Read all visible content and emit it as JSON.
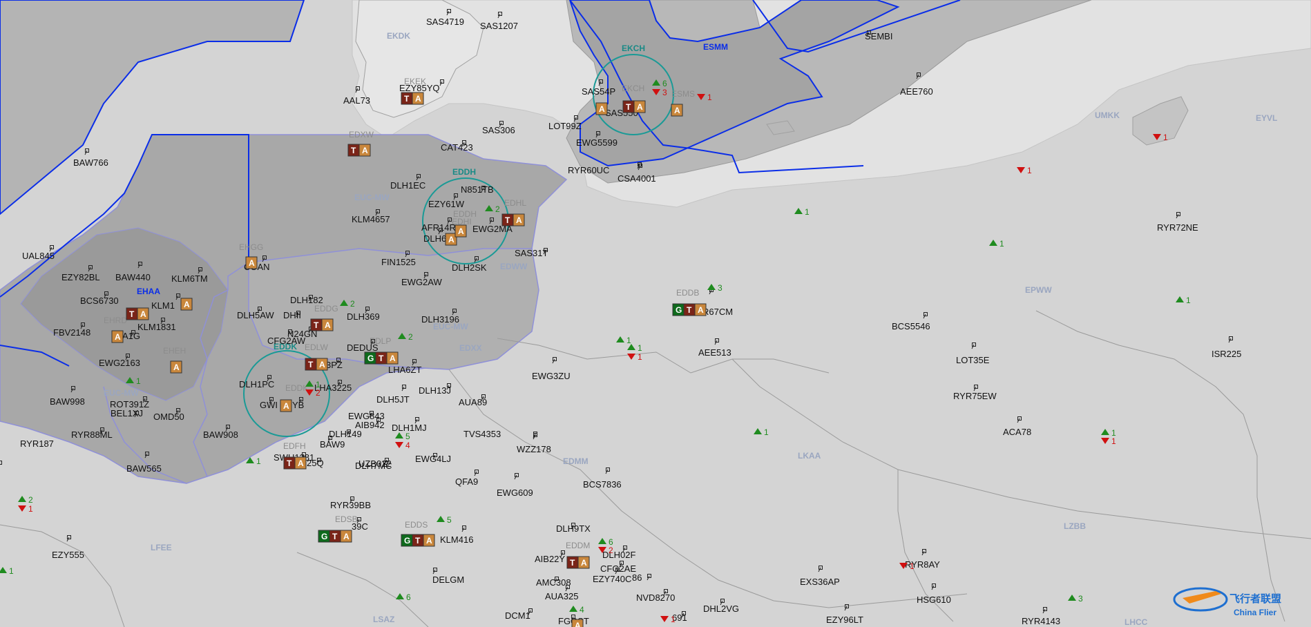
{
  "colors": {
    "land": "#d4d4d4",
    "land_light": "#e2e2e2",
    "region_dark": "#a4a4a4",
    "region_mid": "#b8b8b8",
    "fir_blue": "#0a2de8",
    "fir_light": "#8f90d8",
    "circle": "#1a9a96",
    "tag_brown": "#7a2418",
    "tag_green": "#0e6a1c",
    "tag_orange": "#c9873c",
    "up_arrow": "#1f8b1f",
    "down_arrow": "#d01010",
    "watermark": "#1e6fd0"
  },
  "fir_labels": [
    {
      "id": "ekdk",
      "text": "EKDK"
    },
    {
      "id": "esmm",
      "text": "ESMM"
    },
    {
      "id": "ekch",
      "text": "EKCH"
    },
    {
      "id": "umkk",
      "text": "UMKK"
    },
    {
      "id": "eyvl",
      "text": "EYVL"
    },
    {
      "id": "euc-mw-1",
      "text": "EUC-MW"
    },
    {
      "id": "euc-mw-2",
      "text": "EUC-MW"
    },
    {
      "id": "euc-mw-3",
      "text": "EUC-MW"
    },
    {
      "id": "eddh",
      "text": "EDDH"
    },
    {
      "id": "edww",
      "text": "EDWW"
    },
    {
      "id": "epww",
      "text": "EPWW"
    },
    {
      "id": "eddk",
      "text": "EDDK"
    },
    {
      "id": "edxx",
      "text": "EDXX"
    },
    {
      "id": "ehaa",
      "text": "EHAA"
    },
    {
      "id": "lkaa",
      "text": "LKAA"
    },
    {
      "id": "edmm",
      "text": "EDMM"
    },
    {
      "id": "lzbb",
      "text": "LZBB"
    },
    {
      "id": "lfee",
      "text": "LFEE"
    },
    {
      "id": "lsaz",
      "text": "LSAZ"
    },
    {
      "id": "lhcc",
      "text": "LHCC"
    },
    {
      "id": "ekkk",
      "text": "EKDK"
    }
  ],
  "airports": [
    {
      "id": "ekek",
      "text": "EKEK"
    },
    {
      "id": "ekch-a",
      "text": "EKCH"
    },
    {
      "id": "esms",
      "text": "ESMS"
    },
    {
      "id": "edxw",
      "text": "EDXW"
    },
    {
      "id": "edhl",
      "text": "EDHL"
    },
    {
      "id": "eddh-a",
      "text": "EDDH"
    },
    {
      "id": "edhi",
      "text": "EDHI"
    },
    {
      "id": "ehgg",
      "text": "EHGG"
    },
    {
      "id": "ehrd",
      "text": "EHRD"
    },
    {
      "id": "eheh",
      "text": "EHEH"
    },
    {
      "id": "eddg",
      "text": "EDDG"
    },
    {
      "id": "edlw",
      "text": "EDLW"
    },
    {
      "id": "edlp",
      "text": "EDLP"
    },
    {
      "id": "eddk-a",
      "text": "EDDK"
    },
    {
      "id": "eddb",
      "text": "EDDB"
    },
    {
      "id": "edfh",
      "text": "EDFH"
    },
    {
      "id": "edds",
      "text": "EDDS"
    },
    {
      "id": "edsb",
      "text": "EDSB"
    },
    {
      "id": "eddm",
      "text": "EDDM"
    }
  ],
  "aircraft": [
    {
      "id": "sas4719",
      "text": "SAS4719"
    },
    {
      "id": "sas1207",
      "text": "SAS1207"
    },
    {
      "id": "sembi",
      "text": "SEMBI"
    },
    {
      "id": "ezy85yq",
      "text": "EZY85YQ"
    },
    {
      "id": "aal73",
      "text": "AAL73"
    },
    {
      "id": "sas54p",
      "text": "SAS54P"
    },
    {
      "id": "sas550",
      "text": "SAS550"
    },
    {
      "id": "aee760",
      "text": "AEE760"
    },
    {
      "id": "sas306",
      "text": "SAS306"
    },
    {
      "id": "lot99z",
      "text": "LOT99Z"
    },
    {
      "id": "baw766",
      "text": "BAW766"
    },
    {
      "id": "cat423",
      "text": "CAT423"
    },
    {
      "id": "ewg5599",
      "text": "EWG5599"
    },
    {
      "id": "ryr60uc",
      "text": "RYR60UC"
    },
    {
      "id": "csa4001",
      "text": "CSA4001"
    },
    {
      "id": "dlh1ec",
      "text": "DLH1EC"
    },
    {
      "id": "n851tb",
      "text": "N851TB"
    },
    {
      "id": "ezy61w",
      "text": "EZY61W"
    },
    {
      "id": "klm4657",
      "text": "KLM4657"
    },
    {
      "id": "afr14",
      "text": "AFR14R"
    },
    {
      "id": "ewg2ma",
      "text": "EWG2MA"
    },
    {
      "id": "dlh6",
      "text": "DLH6"
    },
    {
      "id": "ryr72ne",
      "text": "RYR72NE"
    },
    {
      "id": "coan",
      "text": "COAN"
    },
    {
      "id": "sas31t",
      "text": "SAS31T"
    },
    {
      "id": "ual845",
      "text": "UAL845"
    },
    {
      "id": "fin1525",
      "text": "FIN1525"
    },
    {
      "id": "dlh2sk",
      "text": "DLH2SK"
    },
    {
      "id": "ezy82bl",
      "text": "EZY82BL"
    },
    {
      "id": "baw440",
      "text": "BAW440"
    },
    {
      "id": "klm6tm",
      "text": "KLM6TM"
    },
    {
      "id": "ewg2aw",
      "text": "EWG2AW"
    },
    {
      "id": "bcs6730",
      "text": "BCS6730"
    },
    {
      "id": "klm1",
      "text": "KLM1"
    },
    {
      "id": "dlh182",
      "text": "DLH182"
    },
    {
      "id": "ryr67cm",
      "text": "R67CM"
    },
    {
      "id": "klm1831",
      "text": "KLM1831"
    },
    {
      "id": "dlh5aw",
      "text": "DLH5AW"
    },
    {
      "id": "dhii",
      "text": "DHII"
    },
    {
      "id": "dlh369",
      "text": "DLH369"
    },
    {
      "id": "fbv2148",
      "text": "FBV2148"
    },
    {
      "id": "a1g",
      "text": "A1G"
    },
    {
      "id": "n24gn",
      "text": "N24GN"
    },
    {
      "id": "dlh3196",
      "text": "DLH3196"
    },
    {
      "id": "bcs5546",
      "text": "BCS5546"
    },
    {
      "id": "cfg2aw",
      "text": "CFG2AW"
    },
    {
      "id": "dedus",
      "text": "DEDUS"
    },
    {
      "id": "ewg2163",
      "text": "EWG2163"
    },
    {
      "id": "aee513",
      "text": "AEE513"
    },
    {
      "id": "lot35e",
      "text": "LOT35E"
    },
    {
      "id": "isr225",
      "text": "ISR225"
    },
    {
      "id": "e3pz",
      "text": "3PZ"
    },
    {
      "id": "lha6zt",
      "text": "LHA6ZT"
    },
    {
      "id": "ewg3zu",
      "text": "EWG3ZU"
    },
    {
      "id": "dlh1pc",
      "text": "DLH1PC"
    },
    {
      "id": "lha3225",
      "text": "LHA3225"
    },
    {
      "id": "dlh13j",
      "text": "DLH13J"
    },
    {
      "id": "baw998",
      "text": "BAW998"
    },
    {
      "id": "rot391z",
      "text": "ROT391Z"
    },
    {
      "id": "ryr75ew",
      "text": "RYR75EW"
    },
    {
      "id": "gwi",
      "text": "GWI"
    },
    {
      "id": "yb",
      "text": "YB"
    },
    {
      "id": "dlh5jt",
      "text": "DLH5JT"
    },
    {
      "id": "aua89",
      "text": "AUA89"
    },
    {
      "id": "bel1xj",
      "text": "BEL1XJ"
    },
    {
      "id": "omd50",
      "text": "OMD50"
    },
    {
      "id": "ewg843",
      "text": "EWG843"
    },
    {
      "id": "aib942",
      "text": "AIB942"
    },
    {
      "id": "dlh1mj",
      "text": "DLH1MJ"
    },
    {
      "id": "aca78",
      "text": "ACA78"
    },
    {
      "id": "ryr187",
      "text": "RYR187"
    },
    {
      "id": "ryr88ml",
      "text": "RYR88ML"
    },
    {
      "id": "baw908",
      "text": "BAW908"
    },
    {
      "id": "dlh149",
      "text": "DLH149"
    },
    {
      "id": "tvs4353",
      "text": "TVS4353"
    },
    {
      "id": "baw9",
      "text": "BAW9"
    },
    {
      "id": "wzz178",
      "text": "WZZ178"
    },
    {
      "id": "baw565",
      "text": "BAW565"
    },
    {
      "id": "swu",
      "text": "SWU1281"
    },
    {
      "id": "x25q",
      "text": "25Q"
    },
    {
      "id": "uzb",
      "text": "UZB022"
    },
    {
      "id": "ewg4lj",
      "text": "EWG4LJ"
    },
    {
      "id": "dlh7mc",
      "text": "DLH7MC"
    },
    {
      "id": "bcs7836",
      "text": "BCS7836"
    },
    {
      "id": "qfa9",
      "text": "QFA9"
    },
    {
      "id": "ewg609",
      "text": "EWG609"
    },
    {
      "id": "ryr39bb",
      "text": "RYR39BB"
    },
    {
      "id": "ezy555",
      "text": "EZY555"
    },
    {
      "id": "x39c",
      "text": "39C"
    },
    {
      "id": "klm416",
      "text": "KLM416"
    },
    {
      "id": "dlh9tx",
      "text": "DLH9TX"
    },
    {
      "id": "dlh02f",
      "text": "DLH02F"
    },
    {
      "id": "aib22y",
      "text": "AIB22Y"
    },
    {
      "id": "cfg2ae",
      "text": "CFG2AE"
    },
    {
      "id": "ryr8ay",
      "text": "RYR8AY"
    },
    {
      "id": "amc308",
      "text": "AMC308"
    },
    {
      "id": "ezy740",
      "text": "EZY740C"
    },
    {
      "id": "exs36ap",
      "text": "EXS36AP"
    },
    {
      "id": "delgm",
      "text": "DELGM"
    },
    {
      "id": "aua325",
      "text": "AUA325"
    },
    {
      "id": "nvd8270",
      "text": "NVD8270"
    },
    {
      "id": "hsg610",
      "text": "HSG610"
    },
    {
      "id": "dhl2vg",
      "text": "DHL2VG"
    },
    {
      "id": "dcm1",
      "text": "DCM1"
    },
    {
      "id": "fgost",
      "text": "FGOST"
    },
    {
      "id": "x691",
      "text": "691"
    },
    {
      "id": "ezy96lt",
      "text": "EZY96LT"
    },
    {
      "id": "ryr4143",
      "text": "RYR4143"
    },
    {
      "id": "x86",
      "text": "86"
    }
  ],
  "tags": {
    "ta": "TA",
    "a": "A",
    "gta": "GTA",
    "g": "G",
    "t": "T"
  },
  "counts": {
    "ekch_up": "6",
    "ekch_down": "3",
    "esms_down": "1",
    "umkk_down": "1",
    "eyvl_down": "1",
    "east_up_1": "1",
    "epww_up_1": "1",
    "epww_up_2": "1",
    "eddh_up": "2",
    "eddb_up": "3",
    "eddg_up": "2",
    "edlp_up": "2",
    "edxx_up_1": "1",
    "edxx_up_2": "1",
    "edxx_down": "1",
    "eddk_up": "1",
    "eddk_down": "2",
    "euc_up": "1",
    "edfh_up": "5",
    "edfh_down": "4",
    "lkaa_up": "1",
    "ebbr_up": "1",
    "lzbb_up": "1",
    "lzbb_down": "1",
    "west_up": "2",
    "west_down": "1",
    "edds_up": "5",
    "eddm_up": "6",
    "eddm_down": "2",
    "hsg_down": "1",
    "lfee_up": "1",
    "lsaz_up": "6",
    "lo_up": "4",
    "lo_down": "1",
    "lhcc_up": "3"
  },
  "watermark": {
    "cn": "飞行者联盟",
    "en": "China Flier"
  }
}
